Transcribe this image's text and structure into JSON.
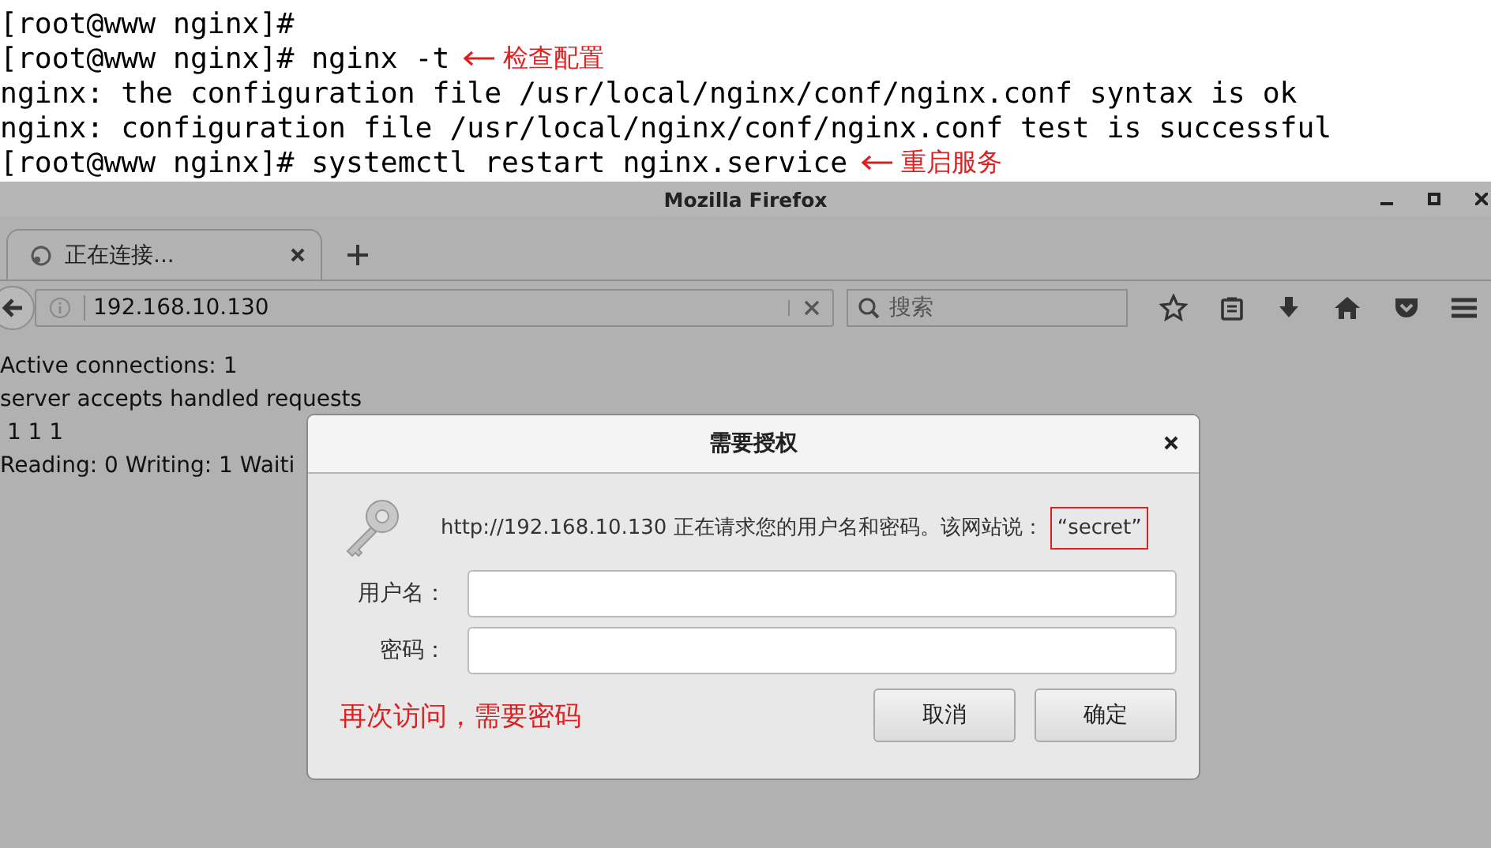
{
  "terminal": {
    "lines": [
      {
        "text": "[root@www nginx]#"
      },
      {
        "text": "[root@www nginx]# nginx -t",
        "annotation": "检查配置"
      },
      {
        "text": "nginx: the configuration file /usr/local/nginx/conf/nginx.conf syntax is ok"
      },
      {
        "text": "nginx: configuration file /usr/local/nginx/conf/nginx.conf test is successful"
      },
      {
        "text": "[root@www nginx]# systemctl restart nginx.service",
        "annotation": "重启服务"
      }
    ]
  },
  "window": {
    "title": "Mozilla Firefox"
  },
  "tabs": [
    {
      "label": "正在连接...",
      "selected": true
    }
  ],
  "address_bar": {
    "value": "192.168.10.130"
  },
  "search": {
    "placeholder": "搜索"
  },
  "page_lines": [
    "Active connections: 1",
    "server accepts handled requests",
    " 1 1 1",
    "Reading: 0 Writing: 1 Waiti"
  ],
  "dialog": {
    "title": "需要授权",
    "message": "http://192.168.10.130 正在请求您的用户名和密码。该网站说：",
    "realm": {
      "text": "“secret”",
      "highlighted": true
    },
    "fields": [
      {
        "label": "用户名："
      },
      {
        "label": "密码："
      }
    ],
    "note": "再次访问，需要密码",
    "buttons": [
      "取消",
      "确定"
    ]
  }
}
